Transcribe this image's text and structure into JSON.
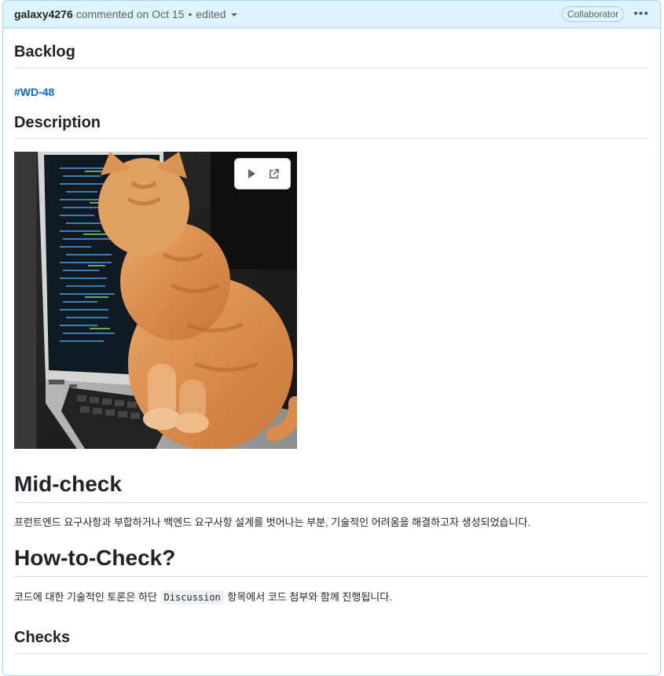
{
  "header": {
    "author": "galaxy4276",
    "action": "commented on Oct 15",
    "separator": "•",
    "edited_label": "edited",
    "badge": "Collaborator",
    "more_icon": "kebab-horizontal-icon"
  },
  "body": {
    "backlog_heading": "Backlog",
    "backlog_link": "#WD-48",
    "description_heading": "Description",
    "media": {
      "image_subject": "orange kitten on a laptop keyboard",
      "play_icon": "play-icon",
      "open_icon": "open-external-icon"
    },
    "midcheck_heading": "Mid-check",
    "midcheck_text": "프런트엔드 요구사항과 부합하거나 백엔드 요구사항 설계를 벗어나는 부분, 기술적인 어려움을 해결하고자 생성되었습니다.",
    "howto_heading": "How-to-Check?",
    "howto_text_before": "코드에 대한 기술적인 토론은 하단",
    "howto_code": "Discussion",
    "howto_text_after": "항목에서 코드 첨부와 함께 진행됩니다.",
    "checks_heading": "Checks"
  },
  "colors": {
    "header_bg": "#ddf4ff",
    "link": "#0969da",
    "border": "#a9d0f5"
  }
}
